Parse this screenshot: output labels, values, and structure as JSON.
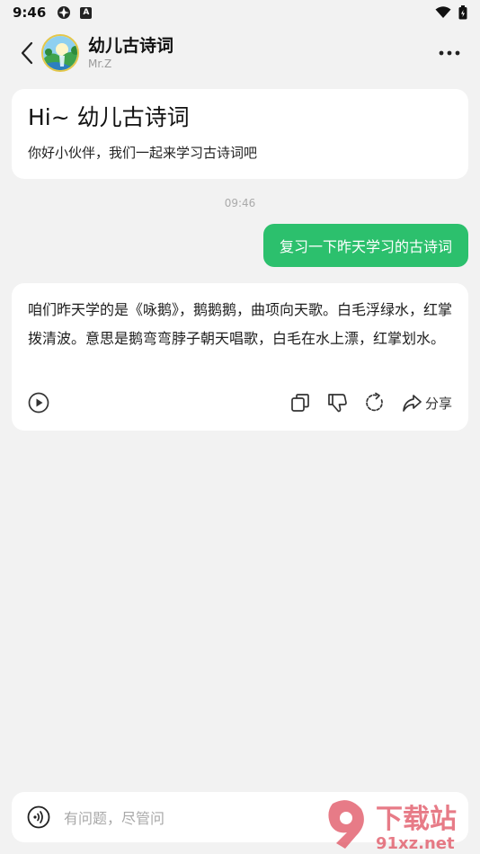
{
  "status_bar": {
    "time": "9:46",
    "a_badge": "A"
  },
  "header": {
    "title": "幼儿古诗词",
    "subtitle": "Mr.Z"
  },
  "welcome": {
    "greeting": "Hi~ 幼儿古诗词",
    "subtext": "你好小伙伴，我们一起来学习古诗词吧"
  },
  "chat": {
    "timestamp": "09:46",
    "user_message": "复习一下昨天学习的古诗词",
    "answer": "咱们昨天学的是《咏鹅》，鹅鹅鹅，曲项向天歌。白毛浮绿水，红掌拨清波。意思是鹅弯弯脖子朝天唱歌，白毛在水上漂，红掌划水。",
    "actions": {
      "share_label": "分享"
    }
  },
  "input": {
    "placeholder": "有问题，尽管问"
  },
  "watermark": {
    "brand": "下载站",
    "domain": "91xz.net"
  },
  "colors": {
    "accent": "#2cc06d",
    "background": "#f2f2f2"
  }
}
